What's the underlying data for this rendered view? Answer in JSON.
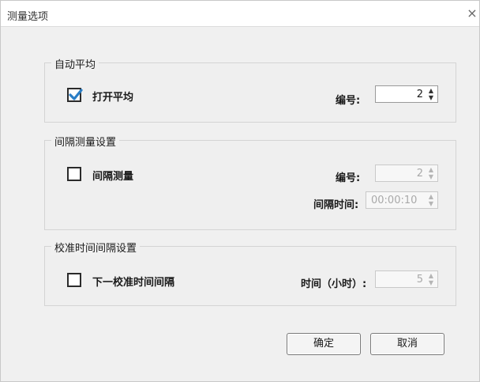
{
  "window": {
    "title": "测量选项",
    "close_glyph": "×"
  },
  "auto_avg": {
    "legend": "自动平均",
    "checkbox_label": "打开平均",
    "checked": true,
    "number_label": "编号:",
    "number_value": "2"
  },
  "interval": {
    "legend": "间隔测量设置",
    "checkbox_label": "间隔测量",
    "checked": false,
    "number_label": "编号:",
    "number_value": "2",
    "time_label": "间隔时间:",
    "time_value": "00:00:10"
  },
  "calib": {
    "legend": "校准时间间隔设置",
    "checkbox_label": "下一校准时间间隔",
    "checked": false,
    "time_label": "时间（小时）:",
    "time_value": "5"
  },
  "buttons": {
    "ok": "确定",
    "cancel": "取消"
  },
  "icons": {
    "spin_up": "▲",
    "spin_down": "▼",
    "check_color": "#2a7ec6"
  }
}
